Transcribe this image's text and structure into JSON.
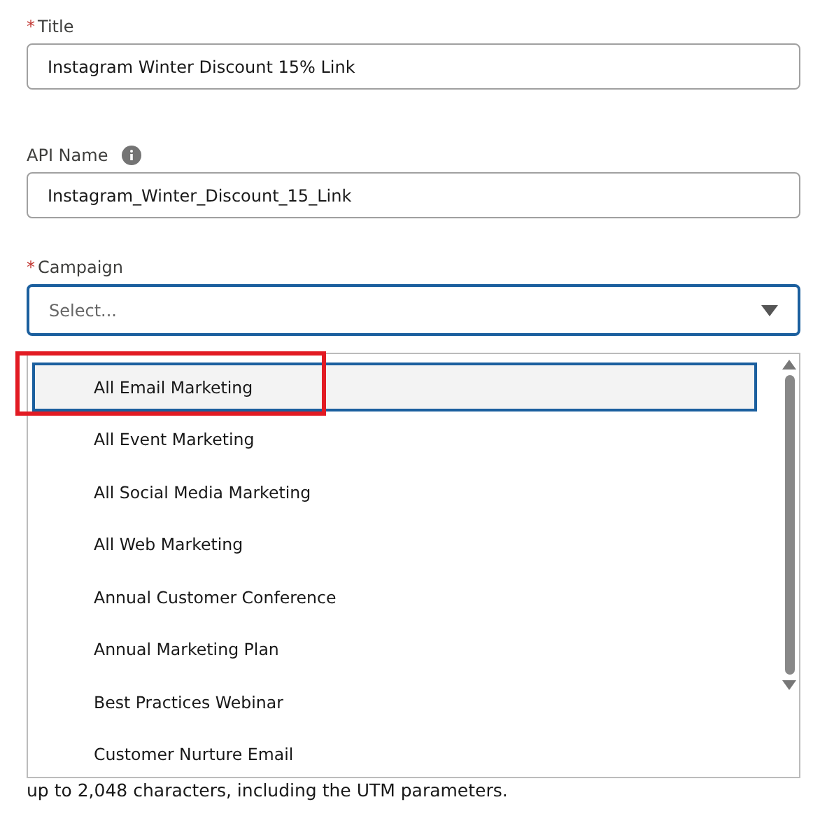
{
  "fields": [
    {
      "kind": "text",
      "label": "Title",
      "required_mark": "*",
      "info": false,
      "value": "Instagram Winter Discount 15% Link"
    },
    {
      "kind": "text",
      "label": "API Name",
      "info": true,
      "value": "Instagram_Winter_Discount_15_Link"
    },
    {
      "kind": "combobox",
      "label": "Campaign",
      "required_mark": "*",
      "info": false,
      "placeholder": "Select..."
    }
  ],
  "options": [
    {
      "label": "All Email Marketing",
      "selected": true,
      "annotated": true
    },
    {
      "label": "All Event Marketing",
      "selected": false,
      "annotated": false
    },
    {
      "label": "All Social Media Marketing",
      "selected": false,
      "annotated": false
    },
    {
      "label": "All Web Marketing",
      "selected": false,
      "annotated": false
    },
    {
      "label": "Annual Customer Conference",
      "selected": false,
      "annotated": false
    },
    {
      "label": "Annual Marketing Plan",
      "selected": false,
      "annotated": false
    },
    {
      "label": "Best Practices Webinar",
      "selected": false,
      "annotated": false
    },
    {
      "label": "Customer Nurture Email",
      "selected": false,
      "annotated": false
    }
  ],
  "help_text": "up to 2,048 characters, including the UTM parameters."
}
